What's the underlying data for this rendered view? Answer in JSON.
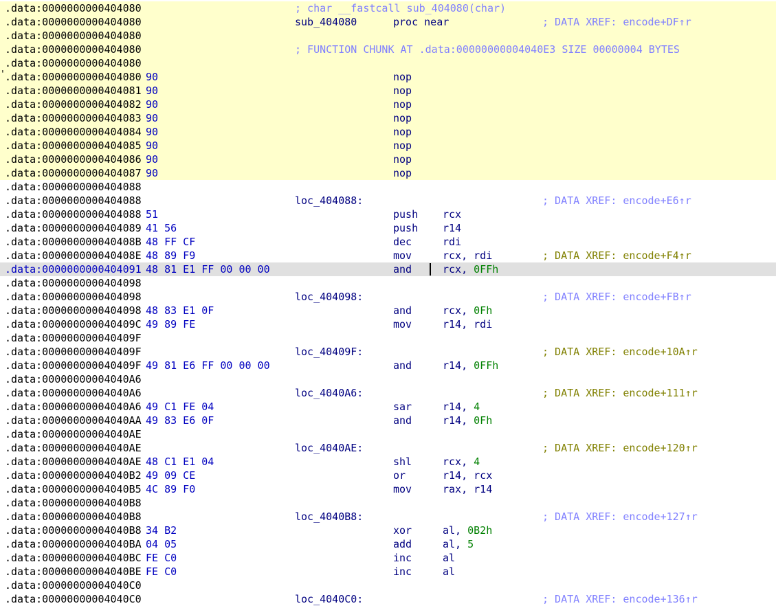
{
  "colors": {
    "function_bg": "#ffffcc",
    "selected_bg": "#e0e0e0",
    "address": "#000000",
    "bytes": "#0000c0",
    "instruction": "#000080",
    "number": "#008000",
    "xref_comment": "#8080ff",
    "xref_comment_highlight": "#808000"
  },
  "rows": [
    {
      "addr": ".data:0000000000404080",
      "comment": "; char __fastcall sub_404080(char)",
      "fn": true
    },
    {
      "addr": ".data:0000000000404080",
      "label": "sub_404080",
      "mnem": "proc near",
      "xref": "; DATA XREF: encode+DF↑r",
      "fn": true
    },
    {
      "addr": ".data:0000000000404080",
      "fn": true
    },
    {
      "addr": ".data:0000000000404080",
      "comment": "; FUNCTION CHUNK AT .data:00000000004040E3 SIZE 00000004 BYTES",
      "fn": true
    },
    {
      "addr": ".data:0000000000404080",
      "fn": true
    },
    {
      "addr": ".data:0000000000404080",
      "bytes": "90",
      "mnem": "nop",
      "fn": true,
      "mark": true
    },
    {
      "addr": ".data:0000000000404081",
      "bytes": "90",
      "mnem": "nop",
      "fn": true
    },
    {
      "addr": ".data:0000000000404082",
      "bytes": "90",
      "mnem": "nop",
      "fn": true
    },
    {
      "addr": ".data:0000000000404083",
      "bytes": "90",
      "mnem": "nop",
      "fn": true
    },
    {
      "addr": ".data:0000000000404084",
      "bytes": "90",
      "mnem": "nop",
      "fn": true
    },
    {
      "addr": ".data:0000000000404085",
      "bytes": "90",
      "mnem": "nop",
      "fn": true
    },
    {
      "addr": ".data:0000000000404086",
      "bytes": "90",
      "mnem": "nop",
      "fn": true
    },
    {
      "addr": ".data:0000000000404087",
      "bytes": "90",
      "mnem": "nop",
      "fn": true
    },
    {
      "addr": ".data:0000000000404088"
    },
    {
      "addr": ".data:0000000000404088",
      "label": "loc_404088:",
      "xref": "; DATA XREF: encode+E6↑r"
    },
    {
      "addr": ".data:0000000000404088",
      "bytes": "51",
      "mnem": "push",
      "ops": "rcx"
    },
    {
      "addr": ".data:0000000000404089",
      "bytes": "41 56",
      "mnem": "push",
      "ops": "r14"
    },
    {
      "addr": ".data:000000000040408B",
      "bytes": "48 FF CF",
      "mnem": "dec",
      "ops": "rdi"
    },
    {
      "addr": ".data:000000000040408E",
      "bytes": "48 89 F9",
      "mnem": "mov",
      "ops": "rcx, rdi",
      "xref": "; DATA XREF: encode+F4↑r",
      "xref_hl": true
    },
    {
      "addr": ".data:0000000000404091",
      "bytes": "48 81 E1 FF 00 00 00",
      "mnem": "and",
      "ops": "rcx, ",
      "num": "0FFh",
      "sel": true
    },
    {
      "addr": ".data:0000000000404098"
    },
    {
      "addr": ".data:0000000000404098",
      "label": "loc_404098:",
      "xref": "; DATA XREF: encode+FB↑r"
    },
    {
      "addr": ".data:0000000000404098",
      "bytes": "48 83 E1 0F",
      "mnem": "and",
      "ops": "rcx, ",
      "num": "0Fh"
    },
    {
      "addr": ".data:000000000040409C",
      "bytes": "49 89 FE",
      "mnem": "mov",
      "ops": "r14, rdi"
    },
    {
      "addr": ".data:000000000040409F"
    },
    {
      "addr": ".data:000000000040409F",
      "label": "loc_40409F:",
      "xref": "; DATA XREF: encode+10A↑r",
      "xref_hl": true
    },
    {
      "addr": ".data:000000000040409F",
      "bytes": "49 81 E6 FF 00 00 00",
      "mnem": "and",
      "ops": "r14, ",
      "num": "0FFh"
    },
    {
      "addr": ".data:00000000004040A6"
    },
    {
      "addr": ".data:00000000004040A6",
      "label": "loc_4040A6:",
      "xref": "; DATA XREF: encode+111↑r",
      "xref_hl": true
    },
    {
      "addr": ".data:00000000004040A6",
      "bytes": "49 C1 FE 04",
      "mnem": "sar",
      "ops": "r14, ",
      "num": "4"
    },
    {
      "addr": ".data:00000000004040AA",
      "bytes": "49 83 E6 0F",
      "mnem": "and",
      "ops": "r14, ",
      "num": "0Fh"
    },
    {
      "addr": ".data:00000000004040AE"
    },
    {
      "addr": ".data:00000000004040AE",
      "label": "loc_4040AE:",
      "xref": "; DATA XREF: encode+120↑r",
      "xref_hl": true
    },
    {
      "addr": ".data:00000000004040AE",
      "bytes": "48 C1 E1 04",
      "mnem": "shl",
      "ops": "rcx, ",
      "num": "4"
    },
    {
      "addr": ".data:00000000004040B2",
      "bytes": "49 09 CE",
      "mnem": "or",
      "ops": "r14, rcx"
    },
    {
      "addr": ".data:00000000004040B5",
      "bytes": "4C 89 F0",
      "mnem": "mov",
      "ops": "rax, r14"
    },
    {
      "addr": ".data:00000000004040B8"
    },
    {
      "addr": ".data:00000000004040B8",
      "label": "loc_4040B8:",
      "xref": "; DATA XREF: encode+127↑r"
    },
    {
      "addr": ".data:00000000004040B8",
      "bytes": "34 B2",
      "mnem": "xor",
      "ops": "al, ",
      "num": "0B2h"
    },
    {
      "addr": ".data:00000000004040BA",
      "bytes": "04 05",
      "mnem": "add",
      "ops": "al, ",
      "num": "5"
    },
    {
      "addr": ".data:00000000004040BC",
      "bytes": "FE C0",
      "mnem": "inc",
      "ops": "al"
    },
    {
      "addr": ".data:00000000004040BE",
      "bytes": "FE C0",
      "mnem": "inc",
      "ops": "al"
    },
    {
      "addr": ".data:00000000004040C0"
    },
    {
      "addr": ".data:00000000004040C0",
      "label": "loc_4040C0:",
      "xref": "; DATA XREF: encode+136↑r"
    }
  ]
}
